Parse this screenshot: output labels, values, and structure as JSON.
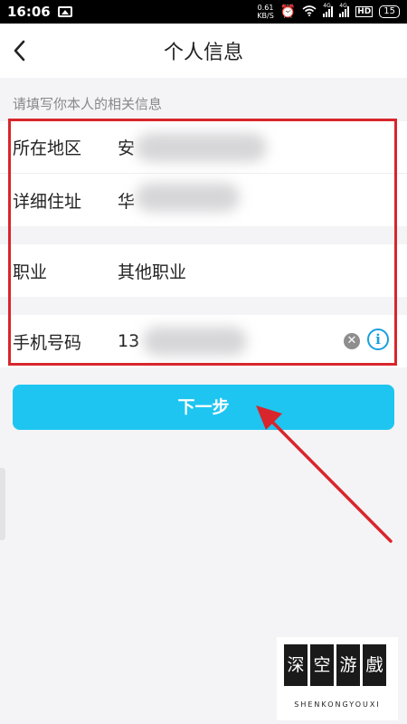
{
  "status_bar": {
    "time": "16:06",
    "speed_value": "0.61",
    "speed_unit": "KB/S",
    "signal_tag_1": "4G",
    "signal_tag_2": "4G",
    "hd": "HD",
    "battery": "15",
    "icons": [
      "image-icon",
      "alarm-icon",
      "wifi-icon",
      "signal-icon",
      "battery-icon"
    ]
  },
  "header": {
    "title": "个人信息",
    "back_icon": "chevron-left-icon"
  },
  "form": {
    "hint": "请填写你本人的相关信息",
    "rows": [
      {
        "label": "所在地区",
        "value": "安"
      },
      {
        "label": "详细住址",
        "value": "华"
      },
      {
        "label": "职业",
        "value": "其他职业"
      },
      {
        "label": "手机号码",
        "value": "13"
      }
    ],
    "clear_icon": "clear-icon",
    "info_icon": "info-icon",
    "info_glyph": "i"
  },
  "actions": {
    "next_label": "下一步"
  },
  "watermark": {
    "chars": [
      "深",
      "空",
      "游",
      "戲"
    ],
    "subtitle": "SHENKONGYOUXI"
  },
  "colors": {
    "accent": "#1ec5f0",
    "annotation": "#d8262c",
    "info": "#1a9fe0"
  }
}
